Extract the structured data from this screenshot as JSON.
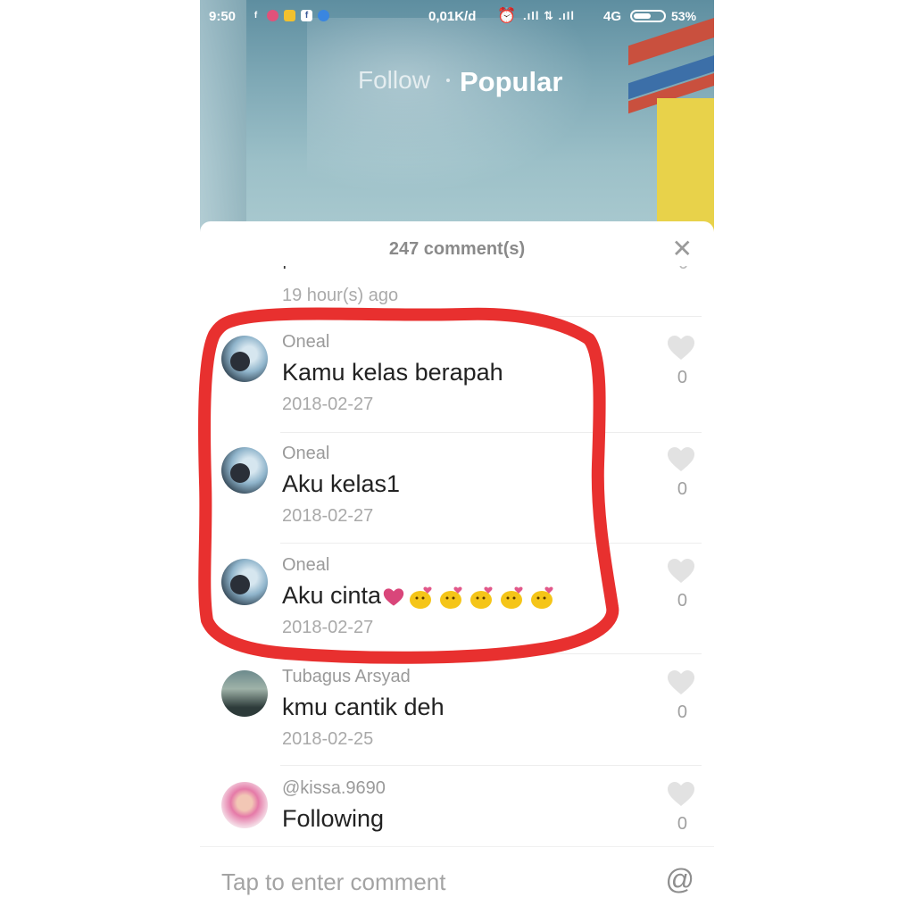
{
  "status_bar": {
    "time": "9:50",
    "speed": "0,01K/d",
    "network": "4G",
    "battery": "53%",
    "icons": [
      "facebook-icon",
      "instagram-icon",
      "message-icon",
      "facebook-icon",
      "app-icon",
      "alarm-icon",
      "signal-icon",
      "data-icon",
      "signal-icon"
    ]
  },
  "tabs": {
    "follow": "Follow",
    "popular": "Popular"
  },
  "sheet": {
    "title": "247 comment(s)",
    "partial_time": "19 hour(s) ago"
  },
  "comments": [
    {
      "name": "Oneal",
      "text": "Kamu kelas berapah",
      "date": "2018-02-27",
      "likes": "0"
    },
    {
      "name": "Oneal",
      "text": "Aku kelas1",
      "date": "2018-02-27",
      "likes": "0"
    },
    {
      "name": "Oneal",
      "text": "Aku cinta",
      "emoji": "heart, 5 kissing-face emojis",
      "date": "2018-02-27",
      "likes": "0"
    },
    {
      "name": "Tubagus Arsyad",
      "text": "kmu cantik deh",
      "date": "2018-02-25",
      "likes": "0"
    },
    {
      "name": "@kissa.9690",
      "text": "Following",
      "likes": "0"
    }
  ],
  "input": {
    "placeholder": "Tap to enter comment",
    "mention_symbol": "@"
  },
  "colors": {
    "highlight": "#e8302f",
    "accent_text": "#222222",
    "muted": "#a9a9a9"
  }
}
